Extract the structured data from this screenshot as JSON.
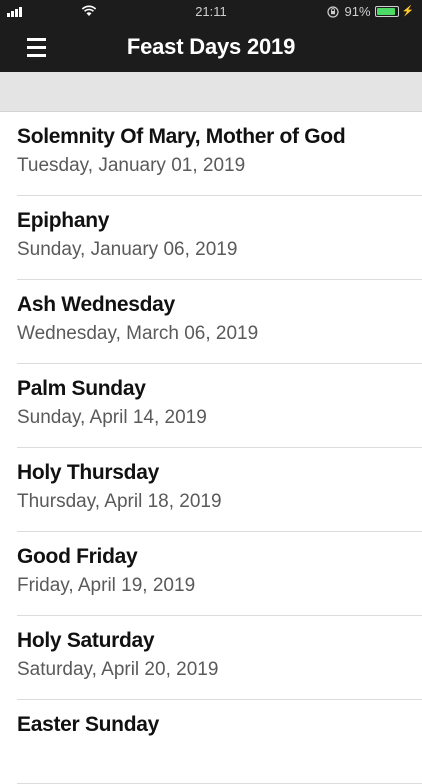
{
  "status_bar": {
    "time": "21:11",
    "battery_percent": "91%",
    "battery_level": 0.91,
    "battery_color": "#4cd964"
  },
  "header": {
    "title": "Feast Days 2019",
    "menu_icon": "hamburger-menu-icon",
    "background": "#1c1c1c"
  },
  "feasts": [
    {
      "name": "Solemnity Of Mary, Mother of God",
      "date": "Tuesday, January 01, 2019"
    },
    {
      "name": "Epiphany",
      "date": "Sunday, January 06, 2019"
    },
    {
      "name": "Ash Wednesday",
      "date": "Wednesday, March 06, 2019"
    },
    {
      "name": "Palm Sunday",
      "date": "Sunday, April 14, 2019"
    },
    {
      "name": "Holy Thursday",
      "date": "Thursday, April 18, 2019"
    },
    {
      "name": "Good Friday",
      "date": "Friday, April 19, 2019"
    },
    {
      "name": "Holy Saturday",
      "date": "Saturday, April 20, 2019"
    },
    {
      "name": "Easter Sunday",
      "date": ""
    }
  ]
}
